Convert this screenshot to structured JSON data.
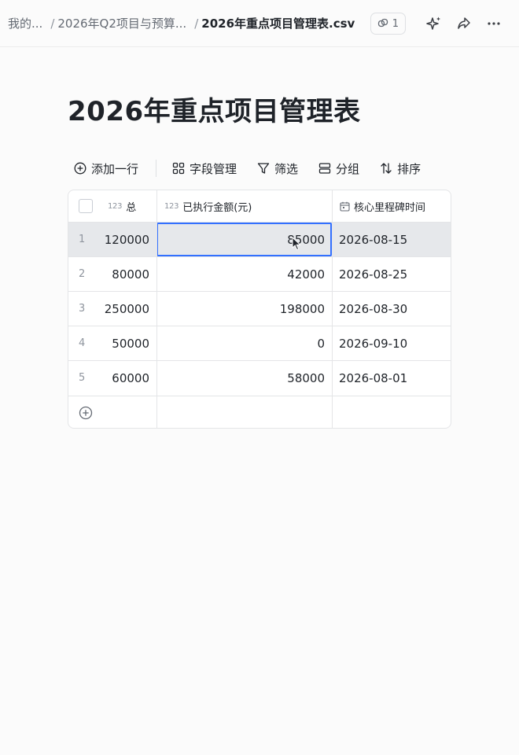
{
  "breadcrumb": {
    "root": "我的...",
    "folder": "2026年Q2项目与预算...",
    "file": "2026年重点项目管理表.csv",
    "separator": "/"
  },
  "topbar": {
    "version_count": "1"
  },
  "page": {
    "title": "2026年重点项目管理表"
  },
  "toolbar": {
    "add_row": "添加一行",
    "fields": "字段管理",
    "filter": "筛选",
    "group": "分组",
    "sort": "排序"
  },
  "table": {
    "columns": {
      "total_tag": "123",
      "total": "总",
      "exec_tag": "123",
      "exec": "已执行金额(元)",
      "date": "核心里程碑时间"
    },
    "rows": [
      {
        "num": "1",
        "total": "120000",
        "exec": "85000",
        "date": "2026-08-15"
      },
      {
        "num": "2",
        "total": "80000",
        "exec": "42000",
        "date": "2026-08-25"
      },
      {
        "num": "3",
        "total": "250000",
        "exec": "198000",
        "date": "2026-08-30"
      },
      {
        "num": "4",
        "total": "50000",
        "exec": "0",
        "date": "2026-09-10"
      },
      {
        "num": "5",
        "total": "60000",
        "exec": "58000",
        "date": "2026-08-01"
      }
    ]
  },
  "colors": {
    "accent": "#3370ff",
    "selected_row": "#e6e8eb",
    "border": "#e4e5e7"
  }
}
